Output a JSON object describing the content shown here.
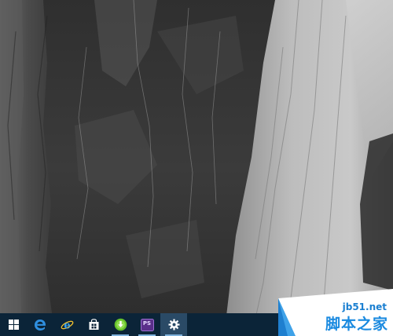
{
  "taskbar": {
    "buttons": [
      {
        "name": "start-button",
        "icon": "windows-logo-icon"
      },
      {
        "name": "edge-button",
        "icon": "edge-browser-icon"
      },
      {
        "name": "ie-button",
        "icon": "internet-explorer-icon"
      },
      {
        "name": "store-button",
        "icon": "store-bag-icon"
      },
      {
        "name": "download-app-button",
        "icon": "green-download-icon"
      },
      {
        "name": "photoshop-button",
        "icon": "photoshop-icon",
        "label": "PS"
      },
      {
        "name": "settings-button",
        "icon": "gear-icon"
      }
    ],
    "colors": {
      "background": "#0b2438",
      "active": "#2a4a66",
      "indicator": "#7fb2dc"
    }
  },
  "watermark": {
    "site": "jb51.net",
    "name": "脚本之家"
  }
}
